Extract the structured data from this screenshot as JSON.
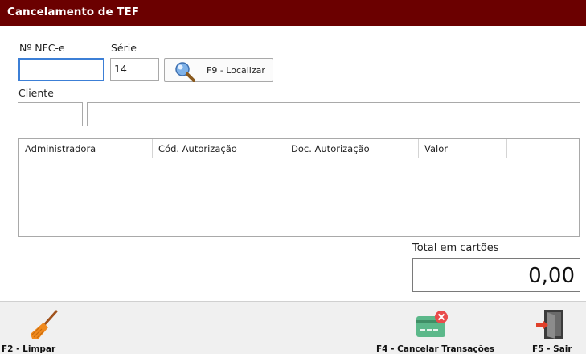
{
  "window": {
    "title": "Cancelamento de TEF"
  },
  "form": {
    "nfce_label": "Nº NFC-e",
    "nfce_value": "",
    "serie_label": "Série",
    "serie_value": "14",
    "localizar_label": "F9 - Localizar",
    "cliente_label": "Cliente",
    "cliente_code": "",
    "cliente_name": ""
  },
  "grid": {
    "columns": [
      "Administradora",
      "Cód. Autorização",
      "Doc. Autorização",
      "Valor",
      ""
    ],
    "rows": []
  },
  "total": {
    "label": "Total em cartões",
    "value": "0,00"
  },
  "footer": {
    "limpar_label": "F2 - Limpar",
    "cancelar_label": "F4 - Cancelar Transações",
    "sair_label": "F5 - Sair"
  },
  "icons": {
    "localizar": "magnifier-icon",
    "limpar": "broom-icon",
    "cancelar": "card-cancel-icon",
    "sair": "exit-door-icon"
  },
  "colors": {
    "titlebar": "#6b0000",
    "focus": "#3c7fd6"
  }
}
